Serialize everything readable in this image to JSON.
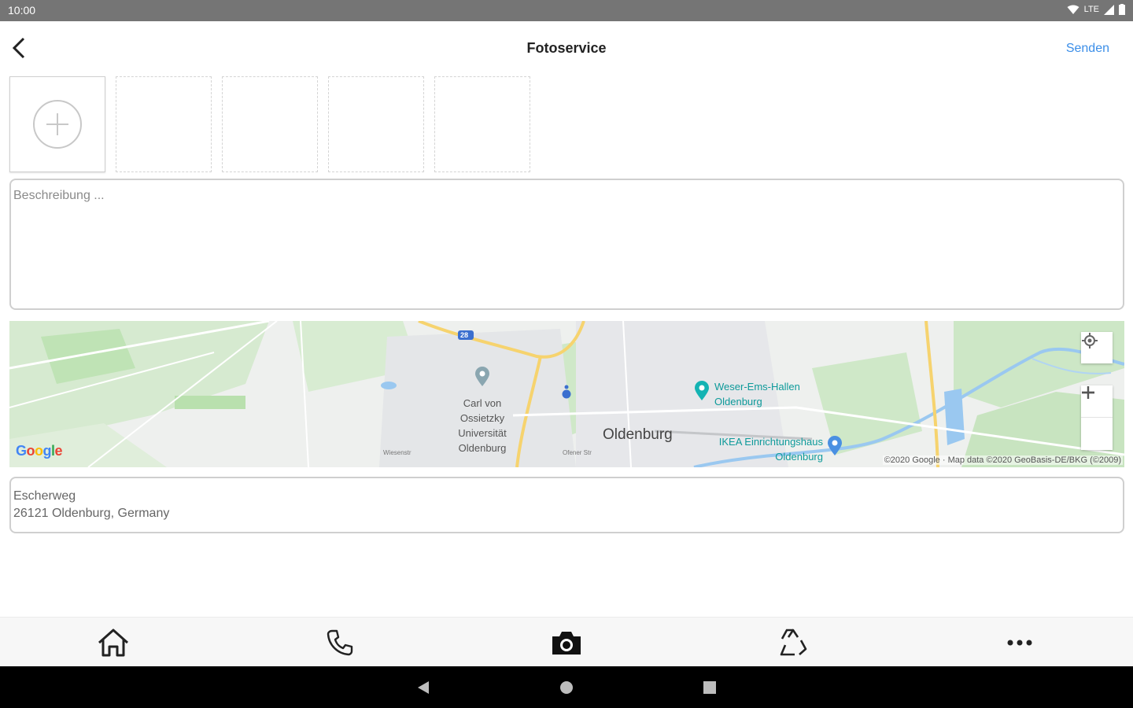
{
  "status_bar": {
    "time": "10:00",
    "network": "LTE"
  },
  "header": {
    "title": "Fotoservice",
    "send_label": "Senden"
  },
  "photos": {
    "slot_count": 4
  },
  "description": {
    "placeholder": "Beschreibung ...",
    "value": ""
  },
  "map": {
    "city_label": "Oldenburg",
    "uni_label": [
      "Carl von",
      "Ossietzky",
      "Universität",
      "Oldenburg"
    ],
    "poi_weser": [
      "Weser-Ems-Hallen",
      "Oldenburg"
    ],
    "poi_ikea": [
      "IKEA Einrichtungshaus",
      "Oldenburg"
    ],
    "road_label_1": "Wiesenstr",
    "road_label_2": "Ofener Str",
    "highway_label": "28",
    "copyright": "©2020 Google · Map data ©2020 GeoBasis-DE/BKG (©2009)",
    "google_letters": [
      "G",
      "o",
      "o",
      "g",
      "l",
      "e"
    ],
    "google_colors": [
      "#4285F4",
      "#EA4335",
      "#FBBC05",
      "#4285F4",
      "#34A853",
      "#EA4335"
    ]
  },
  "address": {
    "line1": "Escherweg",
    "line2": "26121 Oldenburg, Germany"
  },
  "bottom_nav": [
    "home-icon",
    "phone-icon",
    "camera-icon",
    "recycle-icon",
    "more-icon"
  ],
  "colors": {
    "accent": "#3b8ee8",
    "status_bar": "#757575"
  }
}
